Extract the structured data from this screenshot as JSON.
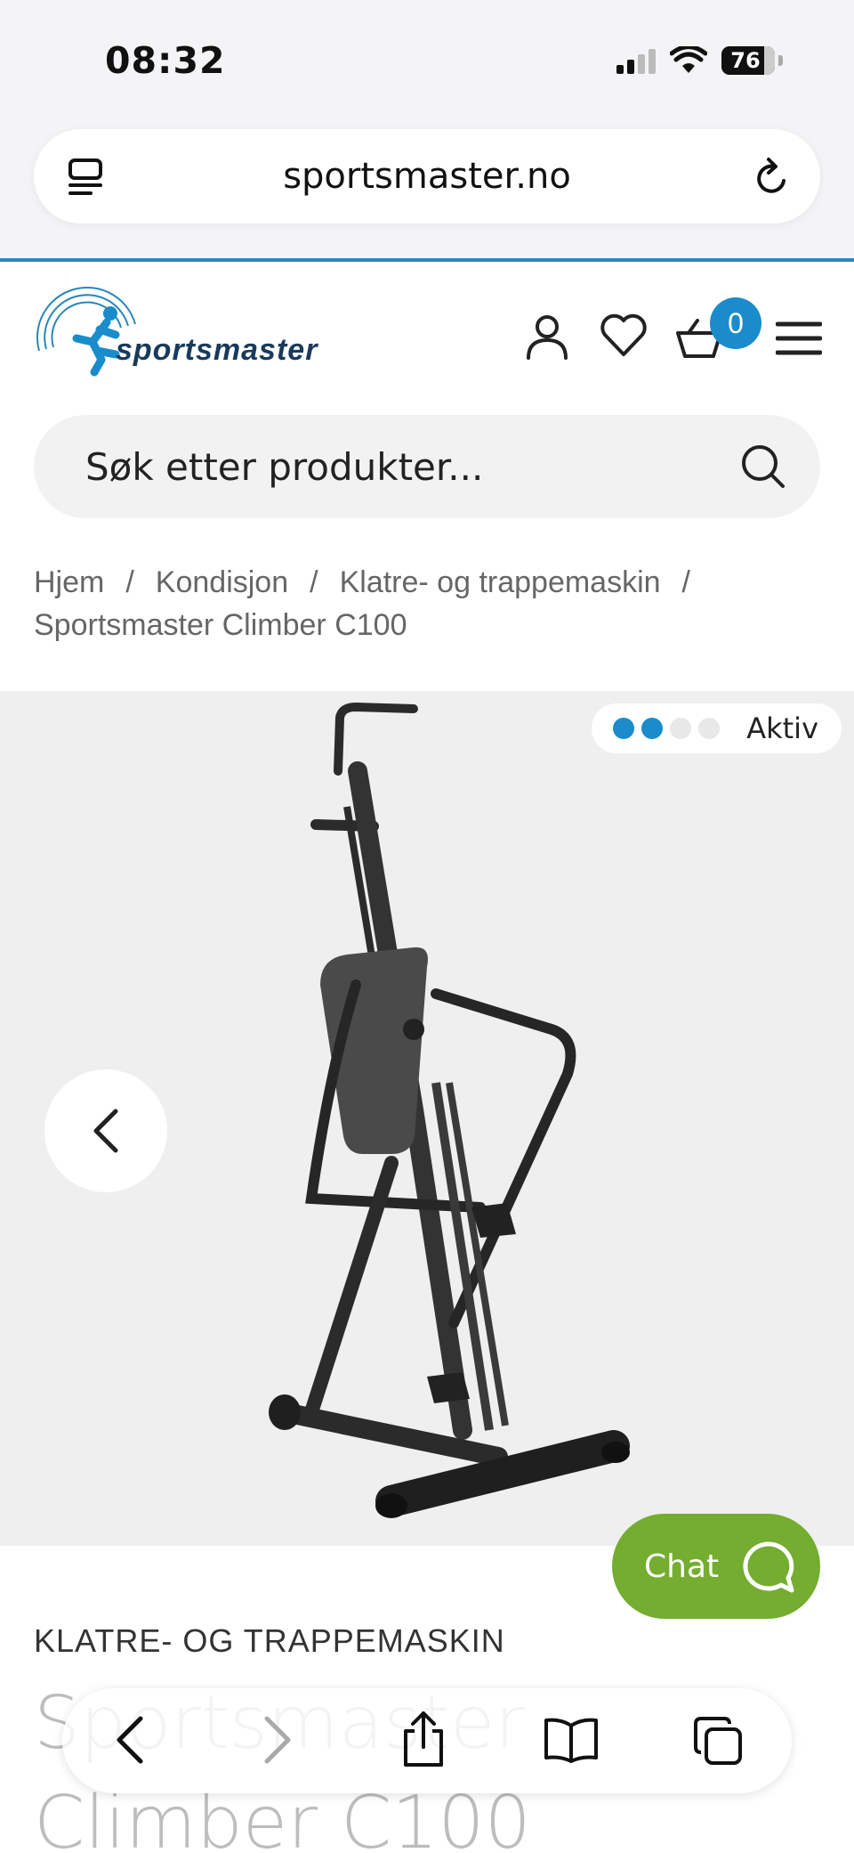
{
  "status_bar": {
    "time": "08:32",
    "battery": "76",
    "icons": [
      "cellular-signal-icon",
      "wifi-icon",
      "battery-icon"
    ]
  },
  "address_bar": {
    "url": "sportsmaster.no",
    "icons": [
      "tabs-menu-icon",
      "reload-icon"
    ]
  },
  "header": {
    "logo_text": "sportsmaster",
    "icons": [
      "account-icon",
      "heart-icon",
      "cart-icon",
      "hamburger-menu-icon"
    ],
    "cart_count": "0",
    "accent_color": "#1a8ccb"
  },
  "search": {
    "placeholder": "Søk etter produkter..."
  },
  "breadcrumb": {
    "items": [
      "Hjem",
      "Kondisjon",
      "Klatre- og trappemaskin",
      "Sportsmaster Climber C100"
    ],
    "separator": "/"
  },
  "gallery": {
    "activity_level": {
      "filled": 2,
      "total": 4,
      "label": "Aktiv"
    },
    "background": "#efefef"
  },
  "chat": {
    "label": "Chat",
    "color": "#74ad2f"
  },
  "product": {
    "category": "KLATRE- OG TRAPPEMASKIN",
    "title": "Sportsmaster Climber C100"
  },
  "toolbar": {
    "icons": [
      "back-icon",
      "forward-icon",
      "share-icon",
      "bookmarks-icon",
      "tabs-icon"
    ]
  }
}
